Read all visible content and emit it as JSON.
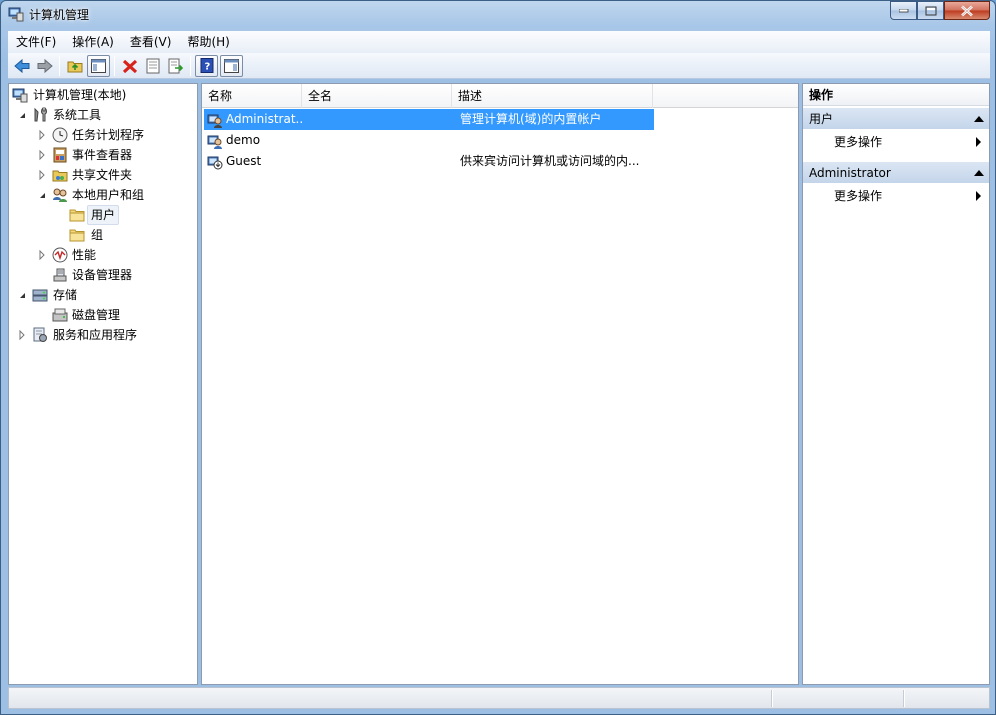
{
  "window": {
    "title": "计算机管理"
  },
  "menu": [
    "文件(F)",
    "操作(A)",
    "查看(V)",
    "帮助(H)"
  ],
  "tree": [
    {
      "label": "计算机管理(本地)",
      "icon": "computer-management-icon"
    },
    {
      "label": "系统工具",
      "icon": "system-tools-icon",
      "expanded": true
    },
    {
      "label": "任务计划程序",
      "icon": "clock-icon"
    },
    {
      "label": "事件查看器",
      "icon": "event-viewer-icon"
    },
    {
      "label": "共享文件夹",
      "icon": "shared-folders-icon"
    },
    {
      "label": "本地用户和组",
      "icon": "users-groups-icon",
      "expanded": true
    },
    {
      "label": "用户",
      "icon": "folder-icon",
      "selected": true
    },
    {
      "label": "组",
      "icon": "folder-icon"
    },
    {
      "label": "性能",
      "icon": "performance-icon"
    },
    {
      "label": "设备管理器",
      "icon": "device-manager-icon"
    },
    {
      "label": "存储",
      "icon": "storage-icon",
      "expanded": true
    },
    {
      "label": "磁盘管理",
      "icon": "disk-management-icon"
    },
    {
      "label": "服务和应用程序",
      "icon": "services-icon"
    }
  ],
  "list": {
    "columns": [
      "名称",
      "全名",
      "描述"
    ],
    "rows": [
      {
        "name": "Administrat...",
        "fullname": "",
        "description": "管理计算机(域)的内置帐户",
        "selected": true
      },
      {
        "name": "demo",
        "fullname": "",
        "description": ""
      },
      {
        "name": "Guest",
        "fullname": "",
        "description": "供来宾访问计算机或访问域的内..."
      }
    ]
  },
  "actions": {
    "header": "操作",
    "sections": [
      {
        "title": "用户",
        "items": [
          "更多操作"
        ]
      },
      {
        "title": "Administrator",
        "items": [
          "更多操作"
        ]
      }
    ]
  },
  "colors": {
    "selection": "#3399ff",
    "accent": "#c4d5ea"
  }
}
